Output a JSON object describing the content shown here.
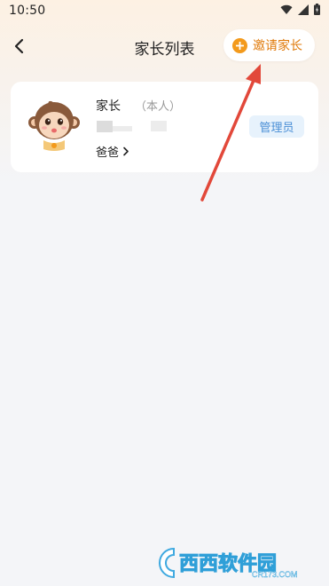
{
  "status_bar": {
    "time": "10:50"
  },
  "nav": {
    "title": "家长列表",
    "invite_label": "邀请家长"
  },
  "members": [
    {
      "name": "家长",
      "self_tag": "（本人）",
      "relation": "爸爸",
      "role": "管理员"
    }
  ],
  "watermark": {
    "brand": "西西软件园",
    "domain": "CR173.COM"
  },
  "colors": {
    "accent": "#f39a1c",
    "invite_text": "#e07a0a",
    "annotation_arrow": "#e2483a",
    "role_badge_bg": "#e7f2fc",
    "role_badge_text": "#4a8fd6"
  },
  "icons": {
    "back": "chevron-left-icon",
    "invite": "plus-circle-icon",
    "relation_more": "chevron-right-icon",
    "avatar": "monkey-avatar"
  }
}
